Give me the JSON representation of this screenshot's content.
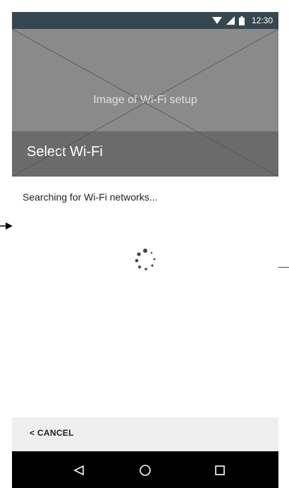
{
  "status_bar": {
    "time": "12:30",
    "icons": [
      "wifi-icon",
      "signal-icon",
      "battery-icon"
    ]
  },
  "hero": {
    "caption": "Image of Wi-Fi setup"
  },
  "header": {
    "title": "Select Wi-Fi"
  },
  "content": {
    "status_text": "Searching for Wi-Fi networks..."
  },
  "actions": {
    "cancel_label": "< CANCEL"
  },
  "nav": {
    "icons": [
      "back-icon",
      "home-icon",
      "recents-icon"
    ]
  },
  "colors": {
    "status_bar": "#37474f",
    "hero": "#8a8a8a",
    "header": "#6b6b6b",
    "cancel_bar": "#efefef",
    "nav_bar": "#000000"
  }
}
